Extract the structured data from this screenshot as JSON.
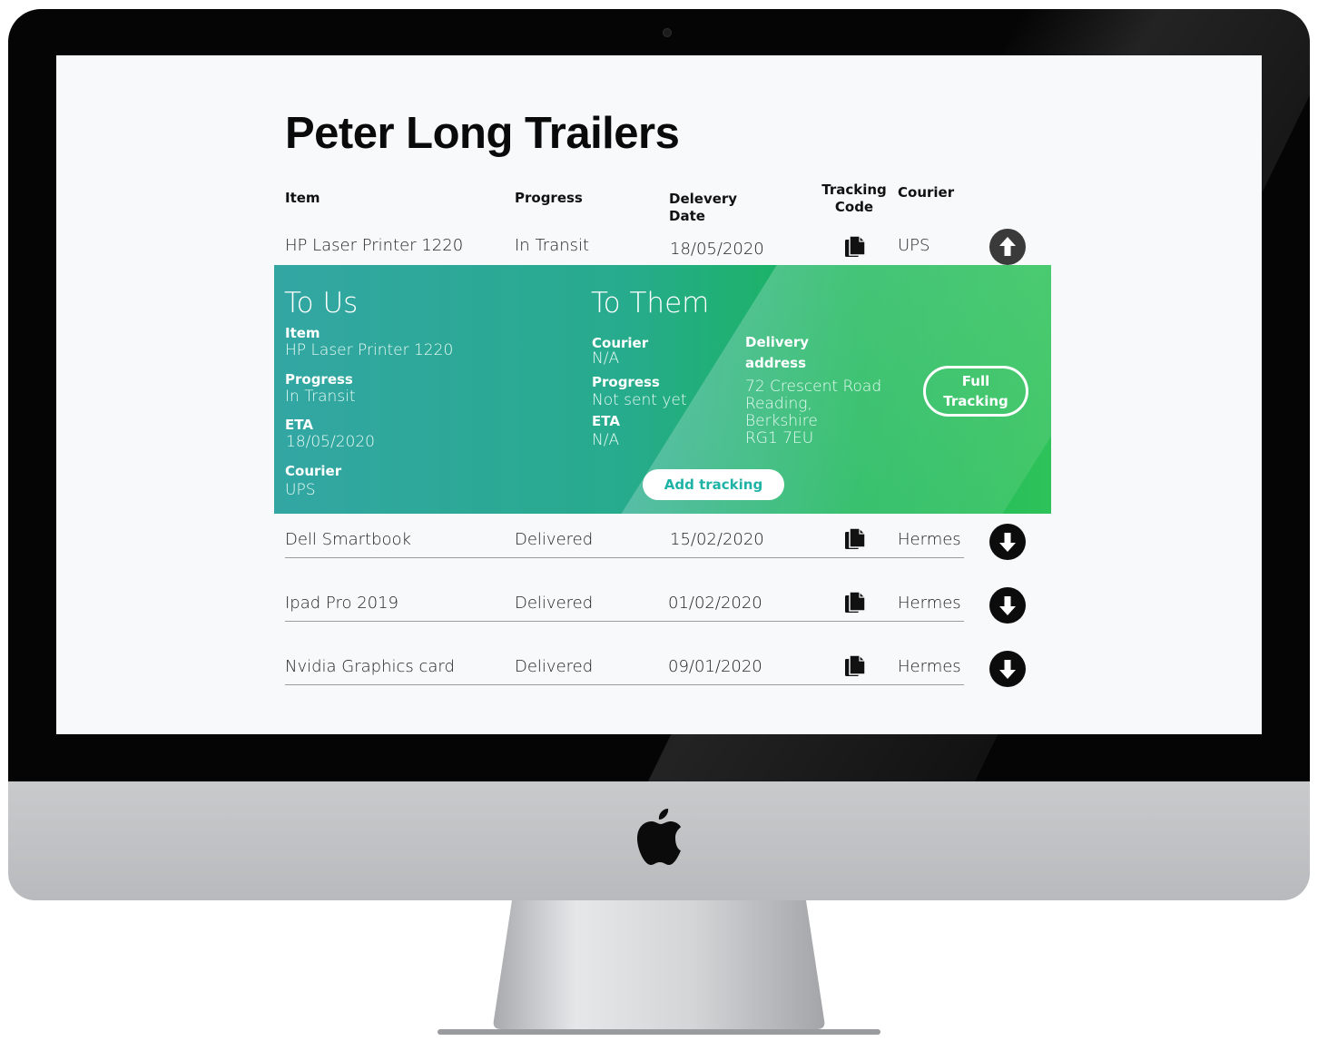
{
  "app": {
    "title": "Peter Long Trailers"
  },
  "table": {
    "headers": {
      "item": "Item",
      "progress": "Progress",
      "delivery_line1": "Delevery",
      "delivery_line2": "Date",
      "tracking_line1": "Tracking",
      "tracking_line2": "Code",
      "courier": "Courier"
    },
    "rows": [
      {
        "item": "HP Laser Printer 1220",
        "progress": "In Transit",
        "date": "18/05/2020",
        "courier": "UPS",
        "expanded": true
      },
      {
        "item": "Dell Smartbook",
        "progress": "Delivered",
        "date": "15/02/2020",
        "courier": "Hermes",
        "expanded": false
      },
      {
        "item": "Ipad Pro 2019",
        "progress": "Delivered",
        "date": "01/02/2020",
        "courier": "Hermes",
        "expanded": false
      },
      {
        "item": "Nvidia Graphics card",
        "progress": "Delivered",
        "date": "09/01/2020",
        "courier": "Hermes",
        "expanded": false
      }
    ]
  },
  "details": {
    "to_us": {
      "heading": "To Us",
      "item_label": "Item",
      "item_value": "HP Laser Printer 1220",
      "progress_label": "Progress",
      "progress_value": "In Transit",
      "eta_label": "ETA",
      "eta_value": "18/05/2020",
      "courier_label": "Courier",
      "courier_value": "UPS"
    },
    "to_them": {
      "heading": "To Them",
      "courier_label": "Courier",
      "courier_value": "N/A",
      "progress_label": "Progress",
      "progress_value": "Not sent yet",
      "eta_label": "ETA",
      "eta_value": "N/A",
      "address_label_line1": "Delivery",
      "address_label_line2": "address",
      "address_lines": [
        "72 Crescent Road",
        "Reading,",
        "Berkshire",
        "RG1 7EU"
      ]
    },
    "full_tracking_line1": "Full",
    "full_tracking_line2": "Tracking",
    "add_tracking": "Add tracking"
  },
  "icons": {
    "copy": "copy-icon",
    "collapse": "arrow-up-circle-icon",
    "expand": "arrow-down-circle-icon",
    "camera": "camera-icon",
    "brand": "apple-logo-icon"
  },
  "colors": {
    "panel_start": "#33a6a3",
    "panel_end": "#2fc25a",
    "add_tracking_text": "#1fb3a6",
    "title": "#0a0a0a"
  }
}
